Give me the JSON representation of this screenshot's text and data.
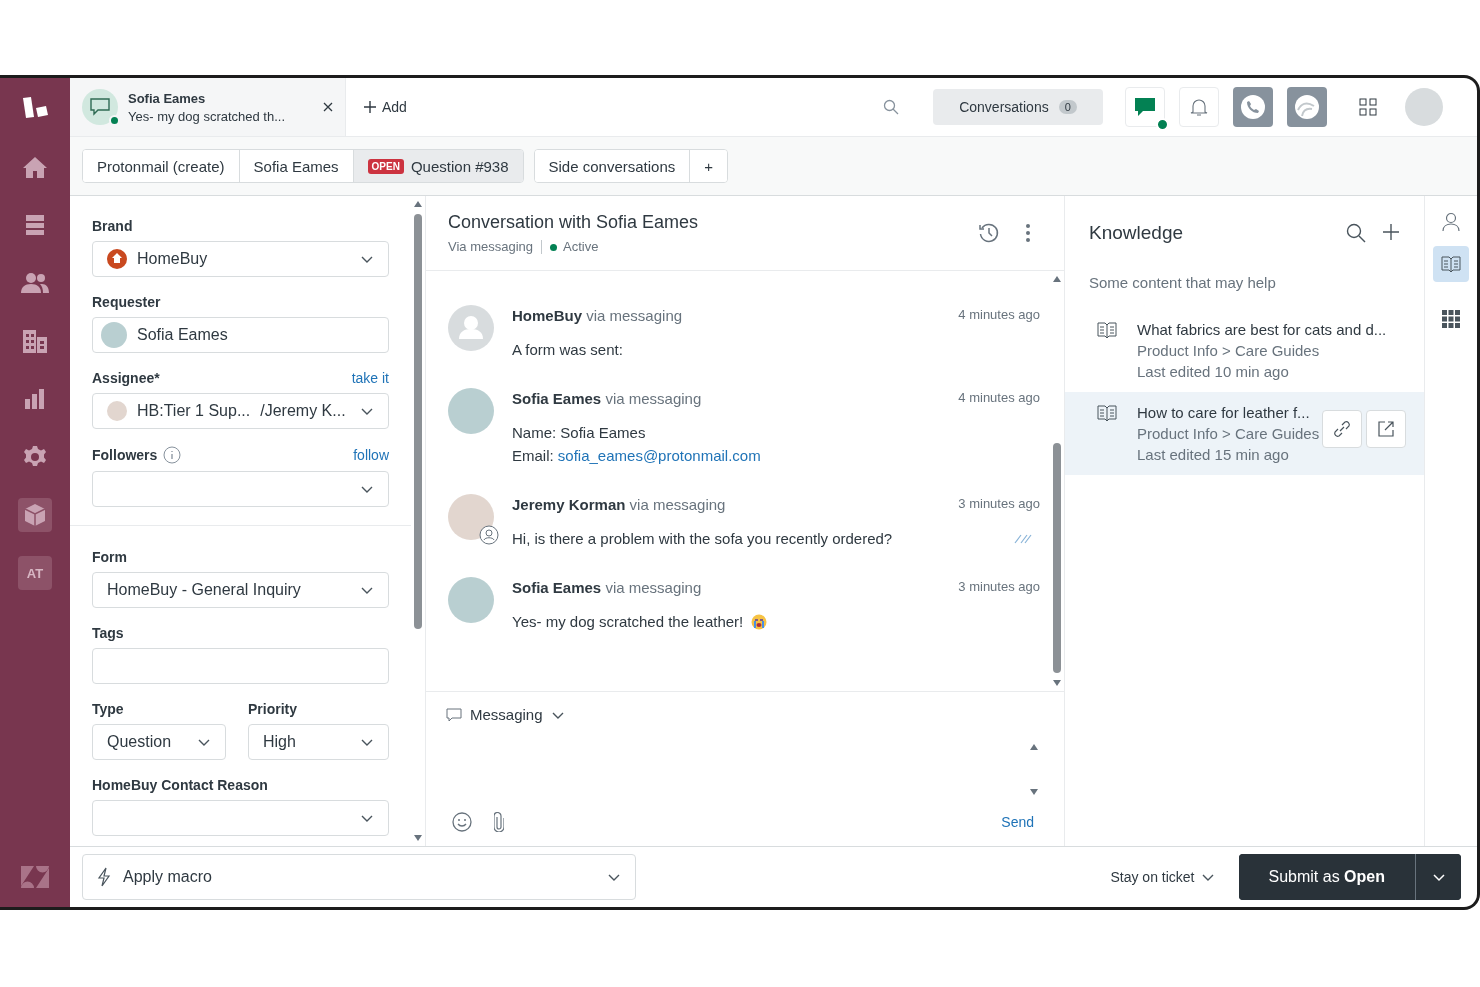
{
  "nav": {
    "items": [
      {
        "kind": "home"
      },
      {
        "kind": "views"
      },
      {
        "kind": "customers"
      },
      {
        "kind": "organizations"
      },
      {
        "kind": "reporting"
      },
      {
        "kind": "settings"
      },
      {
        "kind": "box"
      },
      {
        "kind": "app",
        "label": "AT"
      }
    ]
  },
  "top_bar": {
    "ticket_tab": {
      "name": "Sofia Eames",
      "preview": "Yes- my dog scratched th...",
      "online": true
    },
    "add_label": "Add",
    "conversations": {
      "label": "Conversations",
      "count": "0"
    }
  },
  "ticket_tabs": [
    {
      "label": "Protonmail (create)",
      "selected": false
    },
    {
      "label": "Sofia Eames",
      "selected": false
    },
    {
      "label": "Question #938",
      "badge": "OPEN",
      "selected": true
    }
  ],
  "side_conversations": {
    "label": "Side conversations",
    "add": "+"
  },
  "fields": {
    "brand": {
      "label": "Brand",
      "value": "HomeBuy"
    },
    "requester": {
      "label": "Requester",
      "value": "Sofia Eames"
    },
    "assignee": {
      "label": "Assignee*",
      "link": "take it",
      "group": "HB:Tier 1 Sup...",
      "value": "/Jeremy K..."
    },
    "followers": {
      "label": "Followers",
      "link": "follow"
    },
    "form": {
      "label": "Form",
      "value": "HomeBuy - General Inquiry"
    },
    "tags": {
      "label": "Tags"
    },
    "type": {
      "label": "Type",
      "value": "Question"
    },
    "priority": {
      "label": "Priority",
      "value": "High"
    },
    "contact_reason": {
      "label": "HomeBuy Contact Reason"
    }
  },
  "conversation": {
    "title": "Conversation with Sofia Eames",
    "channel": "Via messaging",
    "status": "Active",
    "messages": [
      {
        "author": "HomeBuy",
        "via": "via messaging",
        "time": "4 minutes ago",
        "kind": "bot",
        "lines": [
          {
            "text": "A form was sent:"
          }
        ]
      },
      {
        "author": "Sofia Eames",
        "via": "via messaging",
        "time": "4 minutes ago",
        "kind": "customer",
        "lines": [
          {
            "text": "Name: Sofia Eames"
          },
          {
            "text": "Email: ",
            "link": "sofia_eames@protonmail.com"
          }
        ]
      },
      {
        "author": "Jeremy Korman",
        "via": "via messaging",
        "time": "3 minutes ago",
        "kind": "agent",
        "read": true,
        "lines": [
          {
            "text": "Hi, is there a problem with the sofa you recently ordered?"
          }
        ]
      },
      {
        "author": "Sofia Eames",
        "via": "via messaging",
        "time": "3 minutes ago",
        "kind": "customer",
        "emoji": true,
        "lines": [
          {
            "text": "Yes- my dog scratched the leather!"
          }
        ]
      }
    ]
  },
  "composer": {
    "channel": "Messaging",
    "send": "Send"
  },
  "knowledge": {
    "title": "Knowledge",
    "subtitle": "Some content that may help",
    "articles": [
      {
        "title": "What fabrics are best for cats and d...",
        "path": "Product Info > Care Guides",
        "edited": "Last edited 10 min ago",
        "selected": false
      },
      {
        "title": "How to care for leather f...",
        "path": "Product Info > Care Guides",
        "edited": "Last edited 15 min ago",
        "selected": true
      }
    ]
  },
  "footer": {
    "macro": "Apply macro",
    "stay": "Stay on ticket",
    "submit": "Submit as **Open**"
  }
}
